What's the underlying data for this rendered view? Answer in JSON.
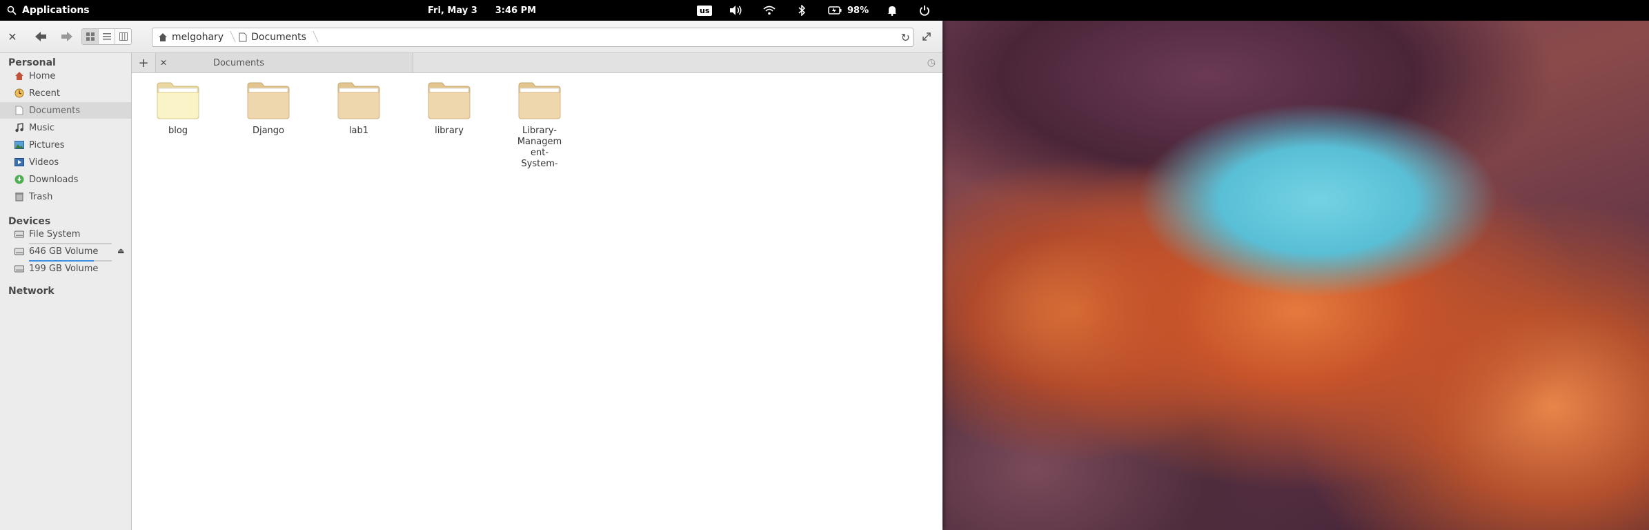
{
  "top_panel": {
    "apps_label": "Applications",
    "date": "Fri, May 3",
    "time": "3:46 PM",
    "keyboard_layout": "us",
    "battery": "98%"
  },
  "toolbar": {
    "breadcrumbs": [
      "melgohary",
      "Documents"
    ]
  },
  "sidebar": {
    "personal_header": "Personal",
    "personal_items": [
      {
        "label": "Home",
        "icon": "home-icon"
      },
      {
        "label": "Recent",
        "icon": "recent-icon"
      },
      {
        "label": "Documents",
        "icon": "documents-icon"
      },
      {
        "label": "Music",
        "icon": "music-icon"
      },
      {
        "label": "Pictures",
        "icon": "pictures-icon"
      },
      {
        "label": "Videos",
        "icon": "videos-icon"
      },
      {
        "label": "Downloads",
        "icon": "downloads-icon"
      },
      {
        "label": "Trash",
        "icon": "trash-icon"
      }
    ],
    "devices_header": "Devices",
    "devices": [
      {
        "label": "File System",
        "usage_fraction": 0.0
      },
      {
        "label": "646 GB Volume",
        "usage_fraction": 0.78
      },
      {
        "label": "199 GB Volume"
      }
    ],
    "network_header": "Network"
  },
  "tabs": [
    {
      "label": "Documents"
    }
  ],
  "folders": [
    {
      "name": "blog"
    },
    {
      "name": "Django"
    },
    {
      "name": "lab1"
    },
    {
      "name": "library"
    },
    {
      "name": "Library-Management-System-"
    }
  ],
  "colors": {
    "accent": "#3d8fe0",
    "folder_light": "#fbf3c8",
    "folder_tan": "#efd7ad"
  }
}
